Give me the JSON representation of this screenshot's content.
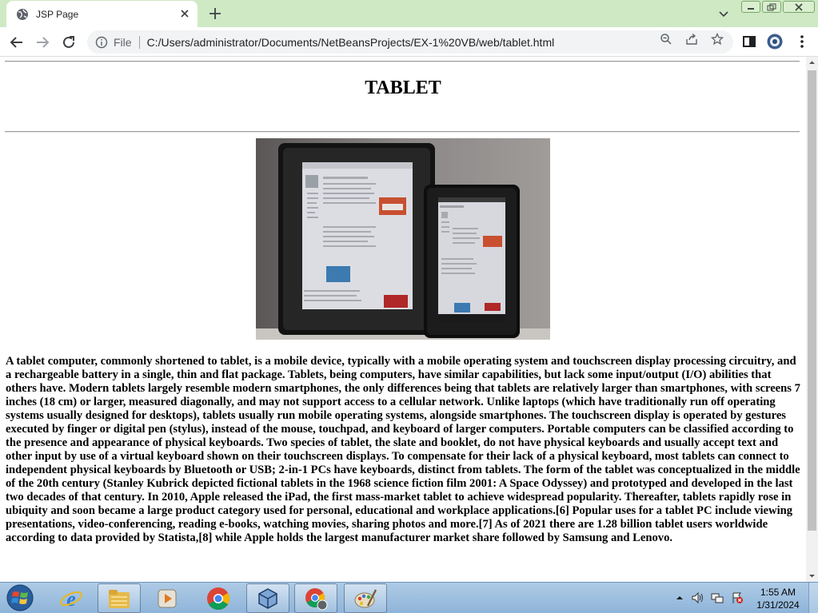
{
  "browser": {
    "tab": {
      "title": "JSP Page",
      "favicon": "globe-icon",
      "close_icon": "close-icon"
    },
    "new_tab_icon": "plus-icon",
    "omnibox": {
      "security_label": "File",
      "url": "C:/Users/administrator/Documents/NetBeansProjects/EX-1%20VB/web/tablet.html"
    },
    "accent_color": "#cfe9c4"
  },
  "page": {
    "heading": "TABLET",
    "image": {
      "subject": "two tablet computers side by side"
    },
    "paragraph": "A tablet computer, commonly shortened to tablet, is a mobile device, typically with a mobile operating system and touchscreen display processing circuitry, and a rechargeable battery in a single, thin and flat package. Tablets, being computers, have similar capabilities, but lack some input/output (I/O) abilities that others have. Modern tablets largely resemble modern smartphones, the only differences being that tablets are relatively larger than smartphones, with screens 7 inches (18 cm) or larger, measured diagonally, and may not support access to a cellular network. Unlike laptops (which have traditionally run off operating systems usually designed for desktops), tablets usually run mobile operating systems, alongside smartphones. The touchscreen display is operated by gestures executed by finger or digital pen (stylus), instead of the mouse, touchpad, and keyboard of larger computers. Portable computers can be classified according to the presence and appearance of physical keyboards. Two species of tablet, the slate and booklet, do not have physical keyboards and usually accept text and other input by use of a virtual keyboard shown on their touchscreen displays. To compensate for their lack of a physical keyboard, most tablets can connect to independent physical keyboards by Bluetooth or USB; 2-in-1 PCs have keyboards, distinct from tablets. The form of the tablet was conceptualized in the middle of the 20th century (Stanley Kubrick depicted fictional tablets in the 1968 science fiction film 2001: A Space Odyssey) and prototyped and developed in the last two decades of that century. In 2010, Apple released the iPad, the first mass-market tablet to achieve widespread popularity. Thereafter, tablets rapidly rose in ubiquity and soon became a large product category used for personal, educational and workplace applications.[6] Popular uses for a tablet PC include viewing presentations, video-conferencing, reading e-books, watching movies, sharing photos and more.[7] As of 2021 there are 1.28 billion tablet users worldwide according to data provided by Statista,[8] while Apple holds the largest manufacturer market share followed by Samsung and Lenovo."
  },
  "taskbar": {
    "apps": [
      "internet-explorer-icon",
      "file-explorer-icon",
      "media-player-icon",
      "chrome-icon",
      "virtualbox-icon",
      "chrome-remote-icon",
      "paint-icon"
    ],
    "clock": {
      "time": "1:55 AM",
      "date": "1/31/2024"
    }
  }
}
